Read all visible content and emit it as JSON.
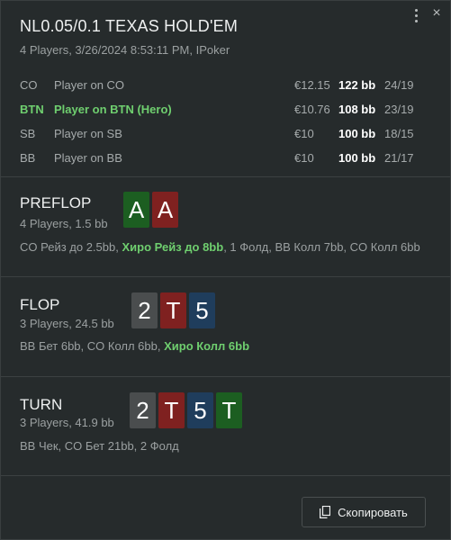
{
  "hand": {
    "title": "NL0.05/0.1 TEXAS HOLD'EM",
    "subtitle": "4 Players, 3/26/2024 8:53:11 PM, IPoker"
  },
  "players": [
    {
      "pos": "CO",
      "name": "Player on CO",
      "money": "€12.15",
      "bb": "122 bb",
      "stat": "24/19",
      "hero": false
    },
    {
      "pos": "BTN",
      "name": "Player on BTN (Hero)",
      "money": "€10.76",
      "bb": "108 bb",
      "stat": "23/19",
      "hero": true
    },
    {
      "pos": "SB",
      "name": "Player on SB",
      "money": "€10",
      "bb": "100 bb",
      "stat": "18/15",
      "hero": false
    },
    {
      "pos": "BB",
      "name": "Player on BB",
      "money": "€10",
      "bb": "100 bb",
      "stat": "21/17",
      "hero": false
    }
  ],
  "streets": [
    {
      "name": "PREFLOP",
      "sub": "4 Players, 1.5 bb",
      "cards": [
        {
          "rank": "A",
          "suit": "clubs"
        },
        {
          "rank": "A",
          "suit": "hearts"
        }
      ],
      "actions": [
        {
          "text": "CO Рейз до 2.5bb, ",
          "hero": false
        },
        {
          "text": "Хиро Рейз до 8bb",
          "hero": true
        },
        {
          "text": ", 1 Фолд, BB Колл 7bb, CO Колл 6bb",
          "hero": false
        }
      ]
    },
    {
      "name": "FLOP",
      "sub": "3 Players, 24.5 bb",
      "cards": [
        {
          "rank": "2",
          "suit": "spades"
        },
        {
          "rank": "T",
          "suit": "hearts"
        },
        {
          "rank": "5",
          "suit": "diamonds"
        }
      ],
      "actions": [
        {
          "text": "BB Бет 6bb, CO Колл 6bb, ",
          "hero": false
        },
        {
          "text": "Хиро Колл 6bb",
          "hero": true
        }
      ]
    },
    {
      "name": "TURN",
      "sub": "3 Players, 41.9 bb",
      "cards": [
        {
          "rank": "2",
          "suit": "spades"
        },
        {
          "rank": "T",
          "suit": "hearts"
        },
        {
          "rank": "5",
          "suit": "diamonds"
        },
        {
          "rank": "T",
          "suit": "clubs"
        }
      ],
      "actions": [
        {
          "text": "BB Чек, CO Бет 21bb, 2 Фолд",
          "hero": false
        }
      ]
    }
  ],
  "colors": {
    "hero": "#6fcf6f",
    "spades": "#4a4d4e",
    "hearts": "#7f2120",
    "diamonds": "#1f3d5c",
    "clubs": "#1c5e21"
  },
  "icons": {
    "menu": "more-vert-icon",
    "close": "close-icon",
    "copy": "copy-icon"
  },
  "close_glyph": "×",
  "copy_label": "Скопировать"
}
